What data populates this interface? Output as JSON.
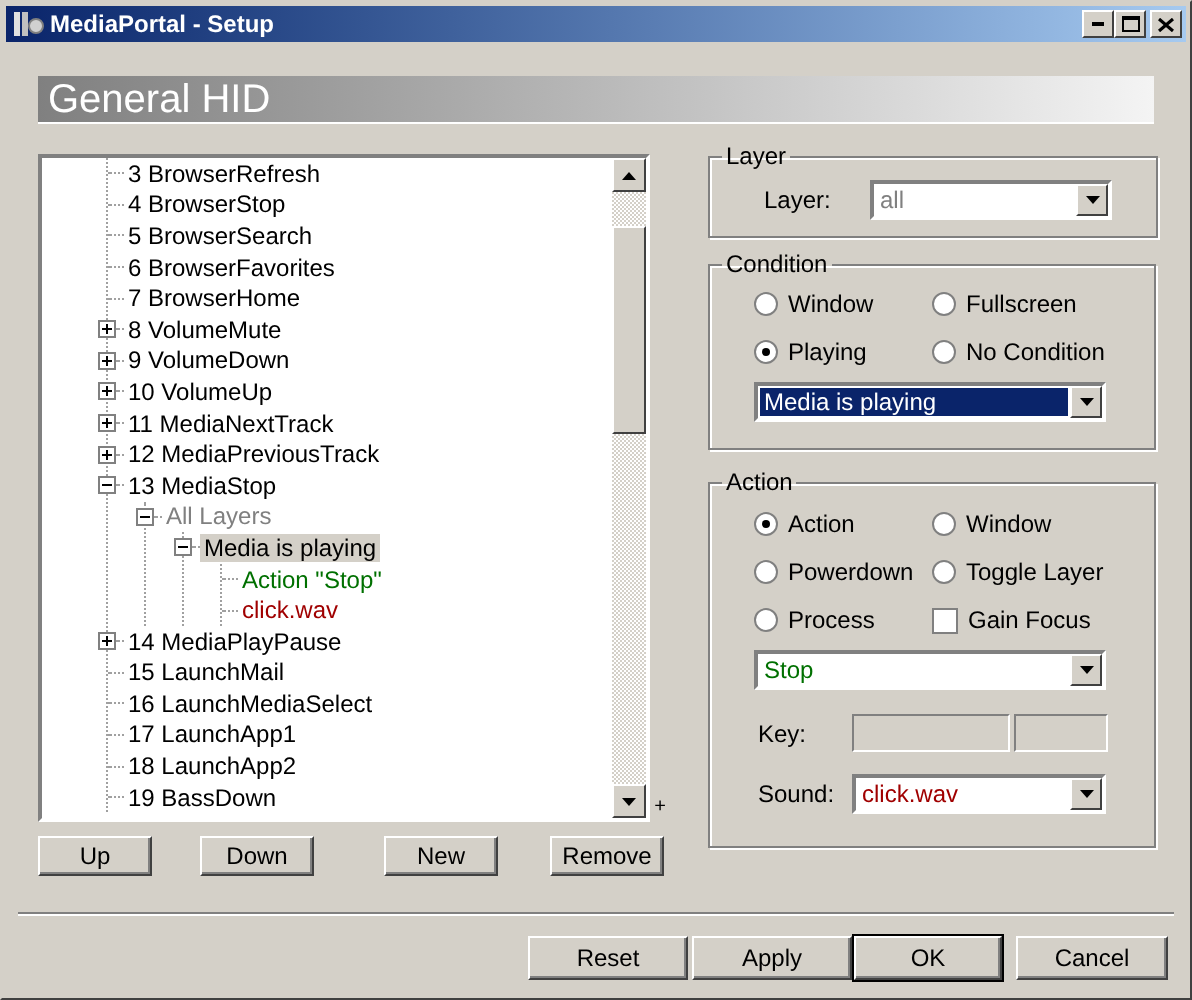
{
  "window": {
    "title": "MediaPortal - Setup"
  },
  "header": {
    "title": "General HID"
  },
  "tree": {
    "nodes": [
      {
        "label": "3 BrowserRefresh",
        "selected": false
      },
      {
        "label": "4 BrowserStop",
        "selected": false
      },
      {
        "label": "5 BrowserSearch",
        "selected": false
      },
      {
        "label": "6 BrowserFavorites",
        "selected": false
      },
      {
        "label": "7 BrowserHome",
        "selected": false
      },
      {
        "label": "8 VolumeMute",
        "selected": false,
        "expanded": false
      },
      {
        "label": "9 VolumeDown",
        "selected": false,
        "expanded": false
      },
      {
        "label": "10 VolumeUp",
        "selected": false,
        "expanded": false
      },
      {
        "label": "11 MediaNextTrack",
        "selected": false,
        "expanded": false
      },
      {
        "label": "12 MediaPreviousTrack",
        "selected": false,
        "expanded": false
      },
      {
        "label": "13 MediaStop",
        "selected": false,
        "expanded": true,
        "children": [
          {
            "label": "All Layers",
            "kind": "layer",
            "selected": false,
            "expanded": true,
            "children": [
              {
                "label": "Media is playing",
                "selected": true,
                "expanded": true,
                "children": [
                  {
                    "label": "Action \"Stop\"",
                    "kind": "action",
                    "selected": false
                  },
                  {
                    "label": "click.wav",
                    "kind": "sound",
                    "selected": false
                  }
                ]
              }
            ]
          }
        ]
      },
      {
        "label": "14 MediaPlayPause",
        "selected": false,
        "expanded": false
      },
      {
        "label": "15 LaunchMail",
        "selected": false
      },
      {
        "label": "16 LaunchMediaSelect",
        "selected": false
      },
      {
        "label": "17 LaunchApp1",
        "selected": false
      },
      {
        "label": "18 LaunchApp2",
        "selected": false
      },
      {
        "label": "19 BassDown",
        "selected": false
      }
    ]
  },
  "tree_mark": "+",
  "tree_buttons": [
    "Up",
    "Down",
    "New",
    "Remove"
  ],
  "layer_group": {
    "title": "Layer",
    "label": "Layer:",
    "value": "all",
    "disabled": true
  },
  "condition_group": {
    "title": "Condition",
    "options": [
      {
        "label": "Window",
        "selected": false
      },
      {
        "label": "Fullscreen",
        "selected": false
      },
      {
        "label": "Playing",
        "selected": true
      },
      {
        "label": "No Condition",
        "selected": false
      }
    ],
    "dropdown": {
      "value": "Media is playing",
      "focused": true
    }
  },
  "action_group": {
    "title": "Action",
    "options": [
      {
        "kind": "radio",
        "label": "Action",
        "selected": true
      },
      {
        "kind": "radio",
        "label": "Window",
        "selected": false
      },
      {
        "kind": "radio",
        "label": "Powerdown",
        "selected": false
      },
      {
        "kind": "radio",
        "label": "Toggle Layer",
        "selected": false
      },
      {
        "kind": "radio",
        "label": "Process",
        "selected": false
      },
      {
        "kind": "checkbox",
        "label": "Gain Focus",
        "checked": false
      }
    ],
    "dropdown": {
      "value": "Stop"
    },
    "key": {
      "label": "Key:",
      "disabled": true
    },
    "sound": {
      "label": "Sound:",
      "value": "click.wav"
    }
  },
  "buttons": [
    "Reset",
    "Apply",
    "OK",
    "Cancel"
  ]
}
